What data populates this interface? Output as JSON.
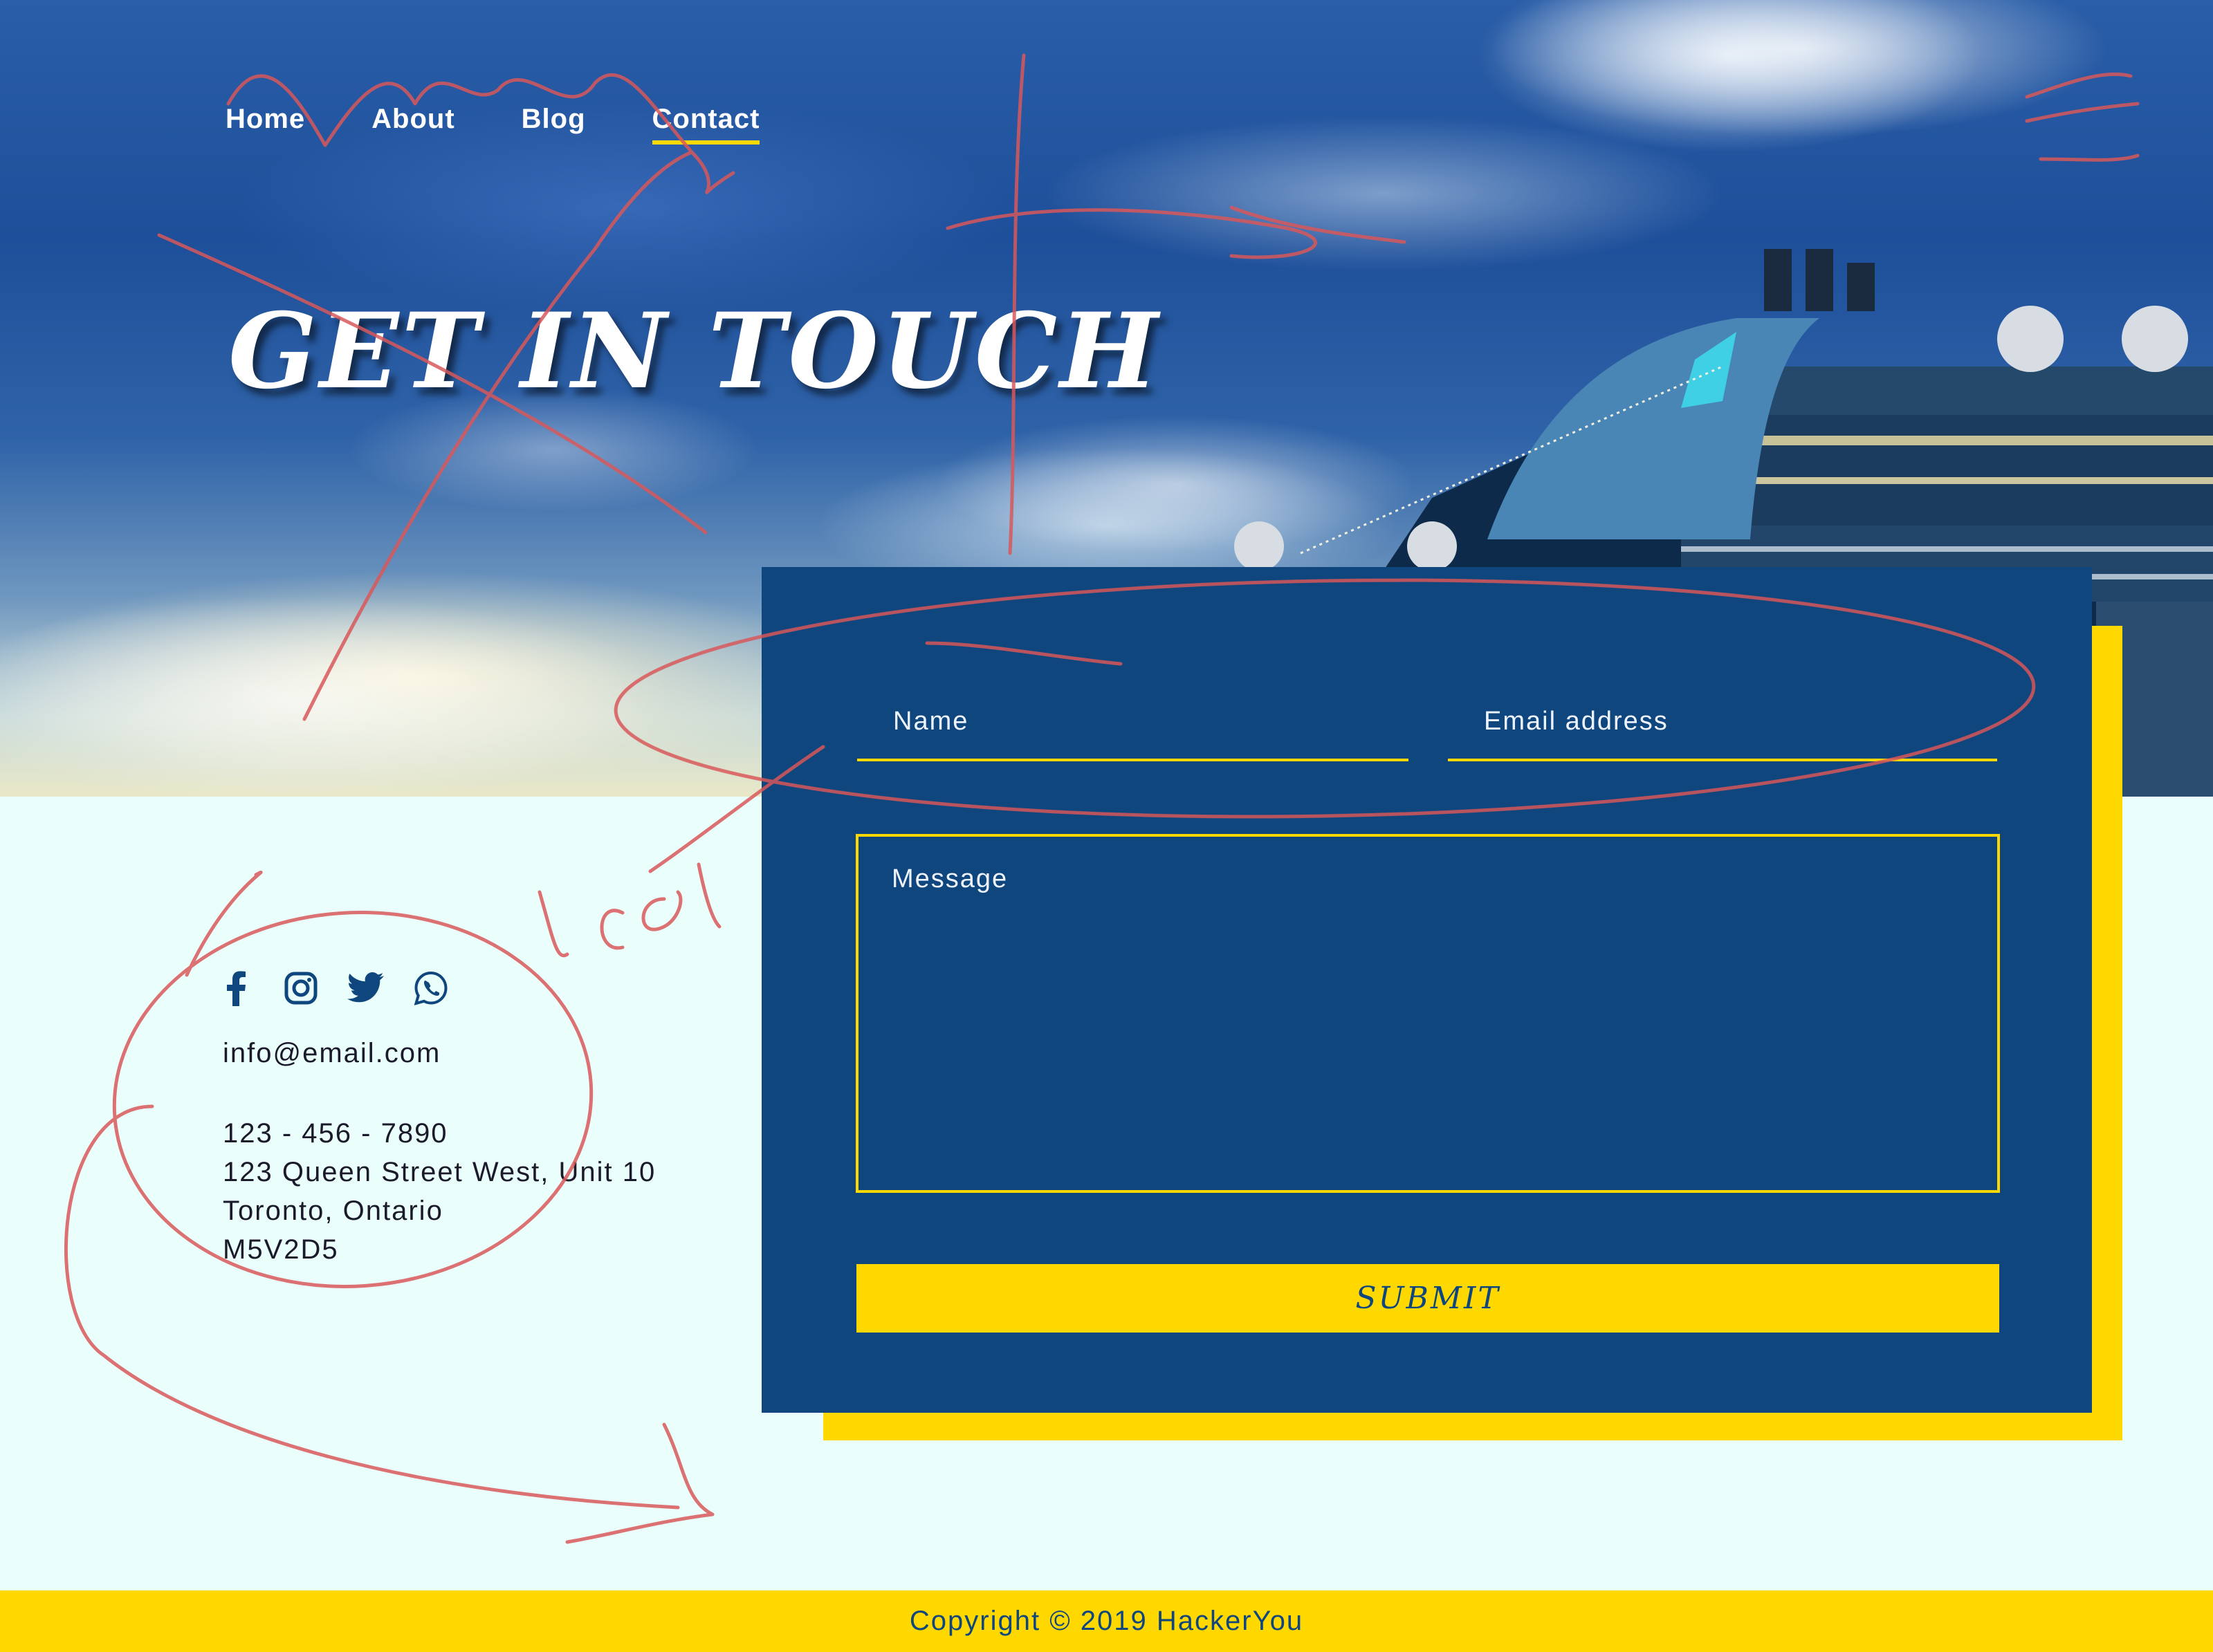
{
  "nav": {
    "items": [
      {
        "label": "Home"
      },
      {
        "label": "About"
      },
      {
        "label": "Blog"
      },
      {
        "label": "Contact",
        "active": true
      }
    ]
  },
  "hero": {
    "title": "GET IN TOUCH"
  },
  "form": {
    "name_placeholder": "Name",
    "email_placeholder": "Email address",
    "message_placeholder": "Message",
    "submit_label": "SUBMIT"
  },
  "social": {
    "icons": [
      "facebook-icon",
      "instagram-icon",
      "twitter-icon",
      "whatsapp-icon"
    ]
  },
  "contact": {
    "email": "info@email.com",
    "phone": "123 - 456 - 7890",
    "address_line1": "123 Queen Street West, Unit 10",
    "address_line2": "Toronto, Ontario",
    "postal_code": "M5V2D5"
  },
  "footer": {
    "copyright": "Copyright © 2019 HackerYou"
  },
  "colors": {
    "navy": "#0f467e",
    "yellow": "#ffd800",
    "background": "#eafffb",
    "scribble": "#d9585a"
  }
}
